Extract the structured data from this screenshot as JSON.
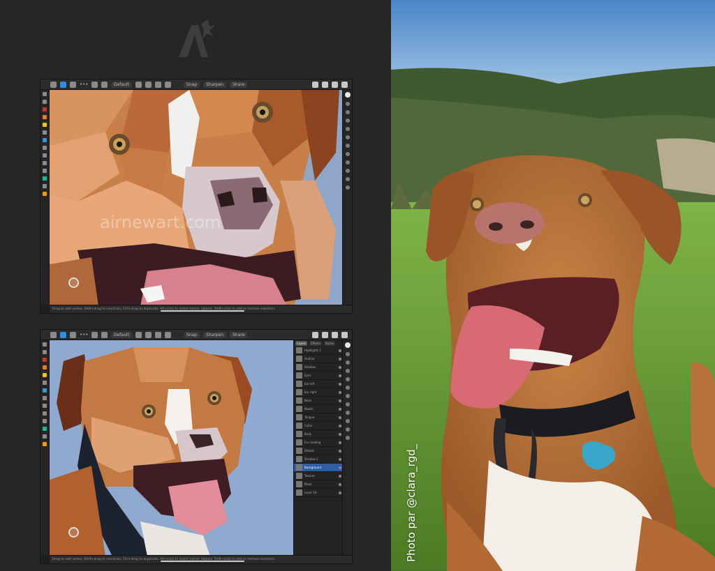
{
  "colors": {
    "background": "#262626",
    "editor_chrome": "#2b2b2b",
    "accent_blue": "#2f8de4",
    "sky": "#6f9fd6",
    "dog_fur": "#b9733a",
    "grass": "#6da23c"
  },
  "logo": {
    "icon": "affinity-designer-logo"
  },
  "editor_top": {
    "toolbar": {
      "persona": "Default",
      "pill_1": "Snap",
      "pill_2": "Sharpen",
      "pill_3": "Share"
    },
    "watermark": "airnewart.com",
    "status": "Drag to add vertex. Shift+drag to constrain, Ctrl+drag to duplicate, Alt+click to select similar objects. Shift+click to add or remove selection."
  },
  "editor_bottom": {
    "toolbar": {
      "persona": "Default",
      "pill_1": "Snap",
      "pill_2": "Sharpen",
      "pill_3": "Share"
    },
    "status": "Drag to add vertex. Shift+drag to constrain, Ctrl+drag to duplicate, Alt+click to select similar objects. Shift+click to add or remove selection.",
    "layers_tabs": [
      "Layers",
      "Effects",
      "Styles"
    ],
    "layers": [
      "Highlights 1",
      "Outline",
      "Shadow",
      "Eyes",
      "Ear left",
      "Ear right",
      "Nose",
      "Mouth",
      "Tongue",
      "Collar",
      "Body",
      "Fur shading",
      "Details",
      "Shadow 2",
      "Background",
      "Texture",
      "Mask",
      "Layer 18"
    ],
    "active_layer_index": 14
  },
  "photo": {
    "credit": "Photo par @clara_rgd_"
  }
}
